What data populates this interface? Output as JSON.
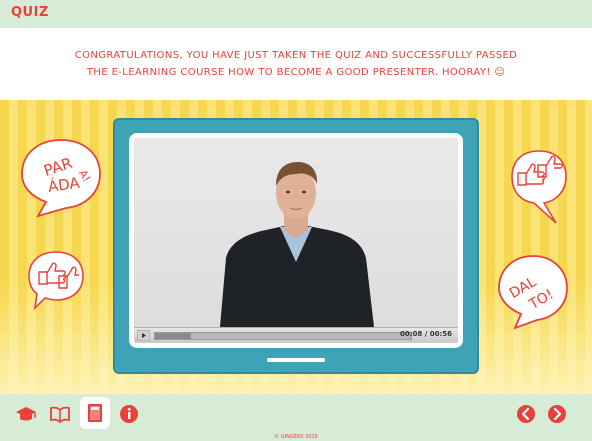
{
  "header": {
    "title": "QUIZ"
  },
  "message": {
    "line1": "CONGRATULATIONS, YOU HAVE JUST TAKEN THE QUIZ AND SUCCESSFULLY PASSED",
    "line2": "THE E-LEARNING COURSE HOW TO BECOME A GOOD PRESENTER. HOORAY!  ☺"
  },
  "bubbles": {
    "left_top": [
      "PAR",
      "ÁDA",
      "A!"
    ],
    "right_bottom": [
      "DAL",
      "TO!"
    ]
  },
  "video": {
    "current_time": "00:08",
    "separator": " / ",
    "duration": "00:56",
    "progress_fraction": 0.14
  },
  "footer": {
    "copyright": "© GINGERS 2015"
  },
  "colors": {
    "accent": "#e8413a",
    "monitor": "#3fa3b8",
    "bar": "#d7ecd7",
    "stripe_a": "#f6d850",
    "stripe_b": "#fae478"
  },
  "icons": [
    "graduation-cap-icon",
    "book-icon",
    "document-icon",
    "info-icon",
    "arrow-left-icon",
    "arrow-right-icon",
    "thumbs-up-icon",
    "play-icon"
  ]
}
